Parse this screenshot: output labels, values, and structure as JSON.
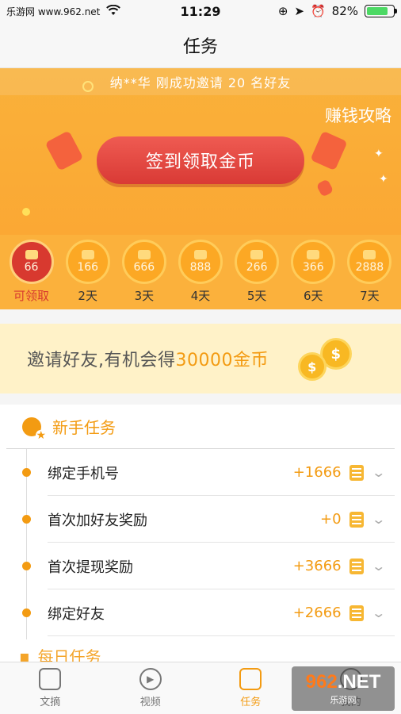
{
  "status": {
    "carrier": "乐游网 www.962.net",
    "time": "11:29",
    "battery": "82%",
    "battery_level": 0.82
  },
  "nav": {
    "title": "任务"
  },
  "banner": {
    "ticker": "纳**华 刚成功邀请 20 名好友",
    "strategy_link": "赚钱攻略",
    "signin_button": "签到领取金币"
  },
  "checkin": {
    "days": [
      {
        "amount": "66",
        "label": "可领取",
        "active": true
      },
      {
        "amount": "166",
        "label": "2天"
      },
      {
        "amount": "666",
        "label": "3天"
      },
      {
        "amount": "888",
        "label": "4天"
      },
      {
        "amount": "266",
        "label": "5天"
      },
      {
        "amount": "366",
        "label": "6天"
      },
      {
        "amount": "2888",
        "label": "7天"
      }
    ]
  },
  "invite": {
    "text_prefix": "邀请好友,有机会得",
    "amount": "30000金币"
  },
  "newbie": {
    "title": "新手任务",
    "tasks": [
      {
        "name": "绑定手机号",
        "reward": "+1666"
      },
      {
        "name": "首次加好友奖励",
        "reward": "+0"
      },
      {
        "name": "首次提现奖励",
        "reward": "+3666"
      },
      {
        "name": "绑定好友",
        "reward": "+2666"
      }
    ]
  },
  "daily": {
    "title": "每日任务"
  },
  "tabbar": {
    "tabs": [
      {
        "label": "文摘"
      },
      {
        "label": "视频"
      },
      {
        "label": "任务",
        "active": true
      },
      {
        "label": "我的"
      }
    ]
  },
  "watermark": {
    "main_prefix": "962",
    "main_suffix": ".NET",
    "sub": "乐游网"
  },
  "colors": {
    "accent": "#f39b12",
    "banner": "#fba834",
    "signin_button": "#d93a35",
    "battery": "#4cd964"
  }
}
